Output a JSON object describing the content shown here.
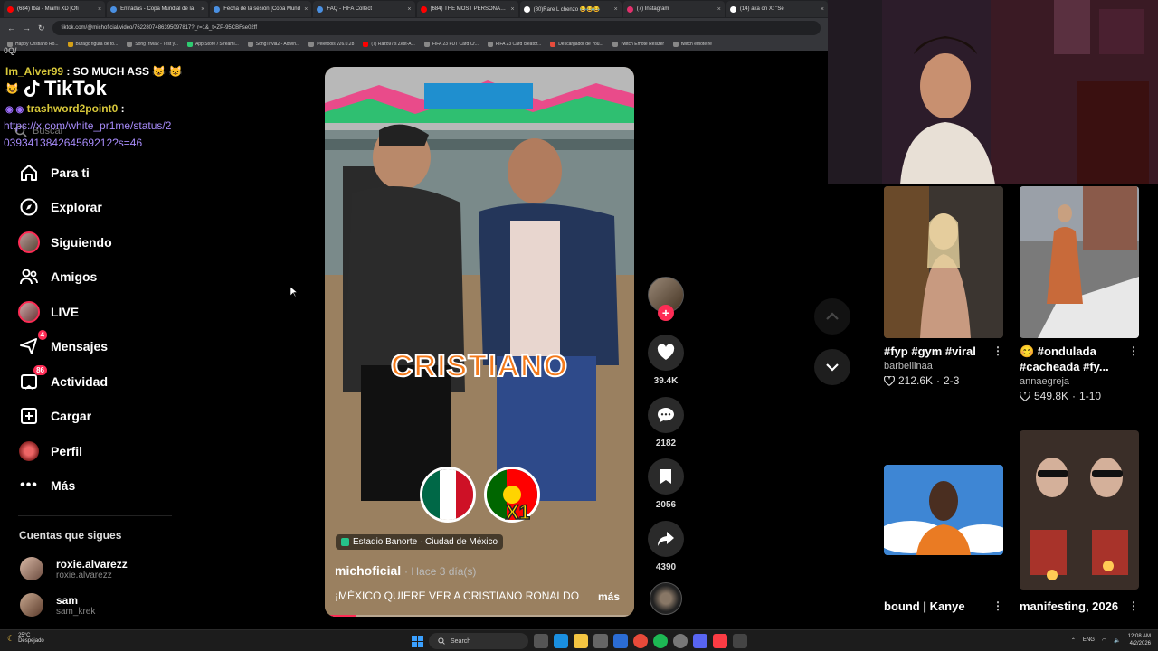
{
  "browser": {
    "tabs": [
      {
        "label": "(684) Ibai - Miami XD [Ofi",
        "color": "#ff0000"
      },
      {
        "label": "Entradas - Copa Mundial de la",
        "color": "#4a90e2"
      },
      {
        "label": "Fecha de la sesión [Copa Mund",
        "color": "#4a90e2"
      },
      {
        "label": "FAQ - FIFA Collect",
        "color": "#4a90e2"
      },
      {
        "label": "(684) THE MOST PERSONAL VI",
        "color": "#ff0000"
      },
      {
        "label": "(80)Rare L chenzo 😂😂😂",
        "color": "#ffffff"
      },
      {
        "label": "(7) Instagram",
        "color": "#e1306c"
      },
      {
        "label": "(14) aka on X: \"Se",
        "color": "#ffffff"
      }
    ],
    "url": "tiktok.com/@michoficial/video/7622807486395097817?_r=1&_t=ZP-95CBFse02ff",
    "bookmarks": [
      {
        "label": "Happy Cristiano Ro...",
        "color": "#888"
      },
      {
        "label": "Burago figura de to...",
        "color": "#d4a017"
      },
      {
        "label": "SongTrivia2 - Test y...",
        "color": "#888"
      },
      {
        "label": "App Store / Streami...",
        "color": "#2ecc71"
      },
      {
        "label": "SongTrivia2 - Adivin...",
        "color": "#888"
      },
      {
        "label": "Peletools v26.0.28",
        "color": "#888"
      },
      {
        "label": "(7) Razo97's Zest-A...",
        "color": "#ff0000"
      },
      {
        "label": "FIFA 23 FUT Card Cr...",
        "color": "#888"
      },
      {
        "label": "FIFA 23 Card creator...",
        "color": "#888"
      },
      {
        "label": "Descargador de You...",
        "color": "#e74c3c"
      },
      {
        "label": "Twitch Emote Resizer",
        "color": "#888"
      },
      {
        "label": "twitch emote re",
        "color": "#888"
      }
    ]
  },
  "chat": {
    "line1_user": "Im_Alver99",
    "line1_text": ": SO MUCH ASS",
    "line2_user": "trashword2point0",
    "line2_text": ":",
    "link_part1": "https://x.com/white_pr1me/status/2",
    "link_part2": "039341384264569212?s=46",
    "stray": "0Q/"
  },
  "tiktok": {
    "logo": "TikTok",
    "search_placeholder": "Buscar",
    "menu": [
      {
        "label": "Para ti",
        "icon": "home-icon"
      },
      {
        "label": "Explorar",
        "icon": "compass-icon"
      },
      {
        "label": "Siguiendo",
        "icon": "following-avatar"
      },
      {
        "label": "Amigos",
        "icon": "friends-icon"
      },
      {
        "label": "LIVE",
        "icon": "live-avatar"
      },
      {
        "label": "Mensajes",
        "icon": "messages-icon",
        "badge": "4"
      },
      {
        "label": "Actividad",
        "icon": "activity-icon",
        "badge": "86"
      },
      {
        "label": "Cargar",
        "icon": "upload-icon"
      },
      {
        "label": "Perfil",
        "icon": "profile-avatar"
      },
      {
        "label": "Más",
        "icon": "more-icon"
      }
    ],
    "following_title": "Cuentas que sigues",
    "following": [
      {
        "name": "roxie.alvarezz",
        "handle": "roxie.alvarezz"
      },
      {
        "name": "sam",
        "handle": "sam_krek"
      }
    ]
  },
  "video": {
    "overlay_text": "CRISTIANO",
    "overlay_x1": "X1",
    "location": "Estadio Banorte · Ciudad de México",
    "author": "michoficial",
    "ago": "· Hace 3 día(s)",
    "caption": "¡MÉXICO QUIERE VER A CRISTIANO RONALDO",
    "more": "más",
    "progress": 0.1,
    "likes": "39.4K",
    "comments": "2182",
    "saves": "2056",
    "shares": "4390",
    "accent": "#fe2c55"
  },
  "grid": [
    {
      "title": "#fyp #gym #viral",
      "user": "barbellinaa",
      "views": "212.6K",
      "index": "2-3"
    },
    {
      "title": "😊 #ondulada #cacheada #fy...",
      "user": "annaegreja",
      "views": "549.8K",
      "index": "1-10"
    },
    {
      "title": "bound | Kanye",
      "user": "",
      "views": "",
      "index": ""
    },
    {
      "title": "manifesting, 2026",
      "user": "",
      "views": "",
      "index": ""
    }
  ],
  "taskbar": {
    "temp": "25°C",
    "weather": "Despejado",
    "search": "Search",
    "lang": "ENG",
    "time": "12:08 AM",
    "date": "4/2/2026"
  }
}
